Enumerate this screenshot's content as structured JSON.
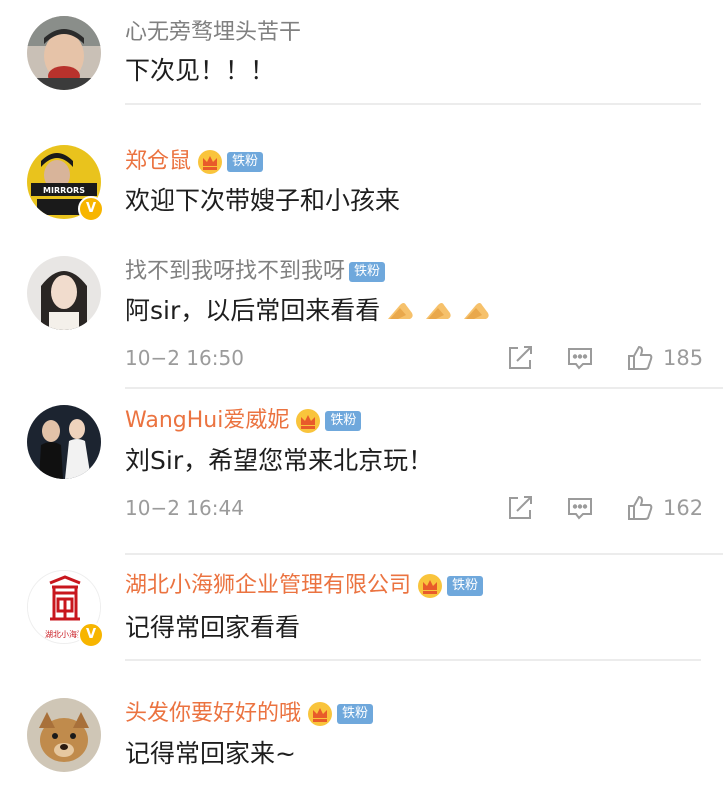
{
  "comments": [
    {
      "name": "心无旁骛埋头苦干",
      "text": "下次见！！！"
    },
    {
      "name": "郑仓鼠",
      "badge": "铁粉",
      "text": "欢迎下次带嫂子和小孩来"
    },
    {
      "name": "找不到我呀找不到我呀",
      "badge": "铁粉",
      "text": "阿sir，以后常回来看看",
      "time": "10−2 16:50",
      "likes": "185"
    },
    {
      "name": "WangHui爱威妮",
      "badge": "铁粉",
      "text": "刘Sir，希望您常来北京玩！",
      "time": "10−2 16:44",
      "likes": "162"
    },
    {
      "name": "湖北小海狮企业管理有限公司",
      "badge": "铁粉",
      "text": "记得常回家看看",
      "avatar_text": "湖北小海狮"
    },
    {
      "name": "头发你要好好的哦",
      "badge": "铁粉",
      "text": "记得常回家来~"
    }
  ],
  "avatars": {
    "c2_text": "MIRRORS"
  },
  "colors": {
    "name_orange": "#eb7340",
    "name_gray": "#808080",
    "fan_badge": "#6fa8dc",
    "verified": "#f7b500"
  },
  "icons": [
    "repost-icon",
    "comment-icon",
    "like-icon",
    "crown-icon",
    "verified-icon",
    "folded-hands-emoji"
  ]
}
